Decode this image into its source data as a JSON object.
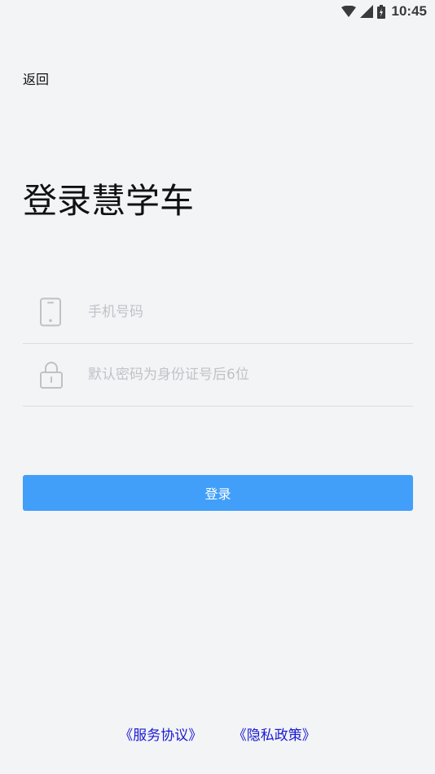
{
  "status_bar": {
    "time": "10:45",
    "icons": [
      "wifi-icon",
      "signal-icon",
      "battery-icon"
    ]
  },
  "header": {
    "back_label": "返回"
  },
  "main": {
    "title": "登录慧学车",
    "phone_field": {
      "icon": "phone-icon",
      "placeholder": "手机号码",
      "value": ""
    },
    "password_field": {
      "icon": "lock-icon",
      "placeholder": "默认密码为身份证号后6位",
      "value": ""
    },
    "login_button_label": "登录"
  },
  "footer": {
    "service_agreement": "《服务协议》",
    "privacy_policy": "《隐私政策》"
  },
  "colors": {
    "background": "#f3f4f6",
    "primary_button": "#419ffa",
    "link": "#1a1ad2",
    "placeholder": "#c0c2c8"
  }
}
